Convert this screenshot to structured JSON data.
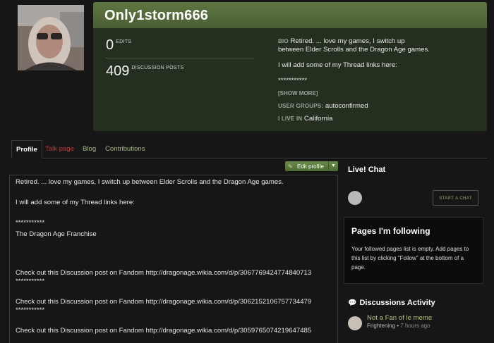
{
  "profile": {
    "username": "Only1storm666",
    "edits_count": "0",
    "edits_label": "EDITS",
    "posts_count": "409",
    "posts_label": "DISCUSSION POSTS",
    "bio_key": "BIO",
    "bio_line1": "Retired. ... love my games, I switch up",
    "bio_line2": "between Elder Scrolls and the Dragon Age games.",
    "bio_threads": "I will add some of my Thread links here:",
    "bio_stars": "***********",
    "show_more": "[SHOW MORE]",
    "user_groups_key": "USER GROUPS:",
    "user_groups_value": "autoconfirmed",
    "live_key": "I LIVE IN",
    "live_value": "California"
  },
  "tabs": {
    "profile": "Profile",
    "talk": "Talk page",
    "blog": "Blog",
    "contributions": "Contributions"
  },
  "edit_button": {
    "label": "Edit profile"
  },
  "content": {
    "line1": "Retired. ... love my games, I switch up between Elder Scrolls and the Dragon Age games.",
    "line2": "I will add some of my Thread links here:",
    "stars1": "***********",
    "franchise": "The Dragon Age Franchise",
    "post1": "Check out this Discussion post on Fandom http://dragonage.wikia.com/d/p/3067769424774840713",
    "stars2": "***********",
    "post2": "Check out this Discussion post on Fandom http://dragonage.wikia.com/d/p/3062152106757734479",
    "stars3": "***********",
    "post3": "Check out this Discussion post on Fandom http://dragonage.wikia.com/d/p/3059765074219647485"
  },
  "chat": {
    "title": "Live! Chat",
    "start_label": "START A CHAT"
  },
  "following": {
    "title": "Pages I'm following",
    "text": "Your followed pages list is empty. Add pages to this list by clicking \"Follow\" at the bottom of a page."
  },
  "discussions": {
    "title": "Discussions Activity",
    "items": [
      {
        "title": "Not a Fan of le meme",
        "category": "Frightening",
        "time": "7 hours ago"
      }
    ]
  }
}
